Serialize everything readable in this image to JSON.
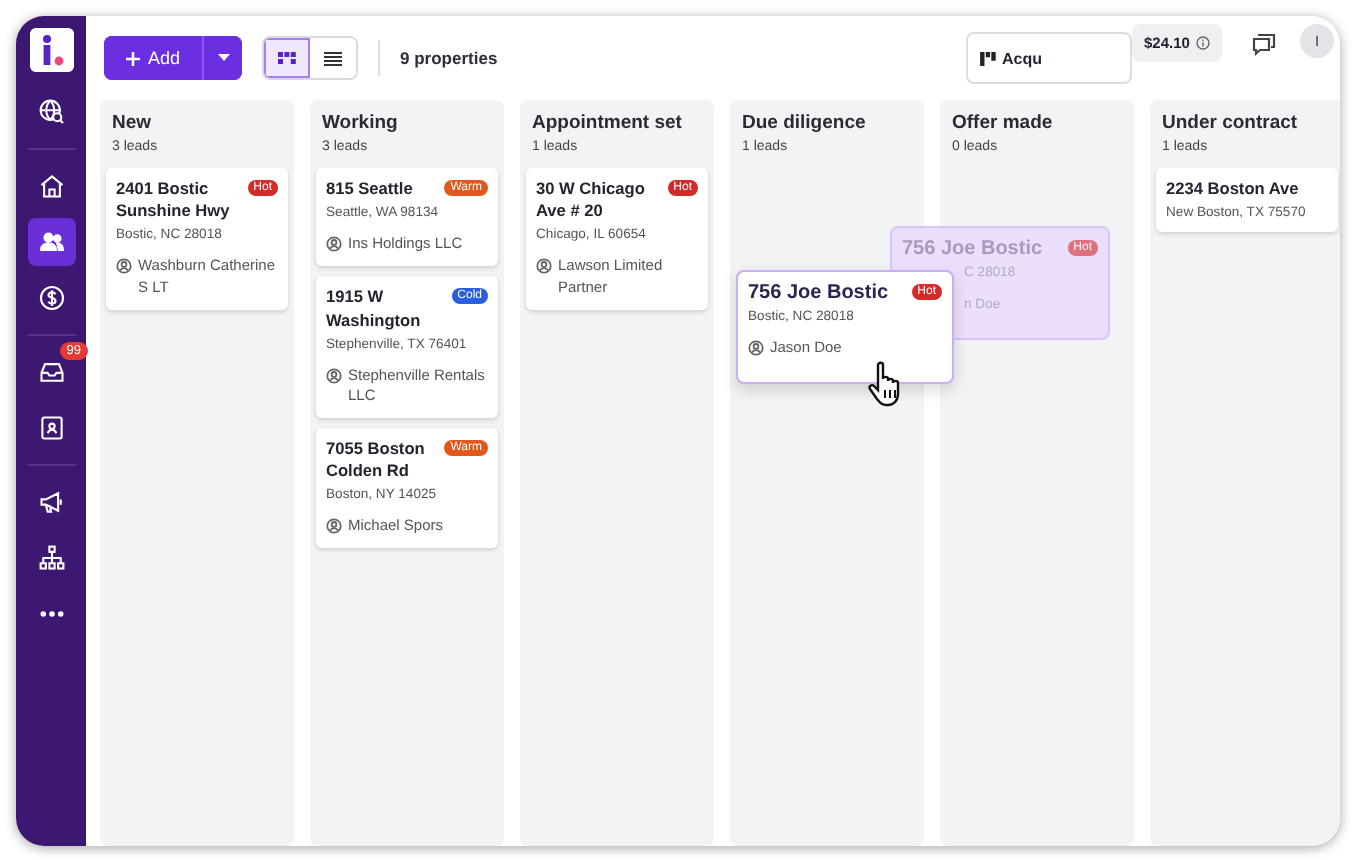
{
  "sidebar": {
    "items": [
      {
        "selected": false
      },
      {
        "selected": false
      },
      {
        "selected": true
      },
      {
        "selected": false
      },
      {
        "selected": false,
        "badge": "99"
      },
      {
        "selected": false
      },
      {
        "selected": false
      },
      {
        "selected": false
      },
      {
        "selected": false
      }
    ]
  },
  "toolbar": {
    "add_button": "Add",
    "views": [
      {
        "selected": true
      },
      {
        "selected": false
      }
    ],
    "count": "9 properties",
    "filter": "Acqu",
    "balance": "$24.10",
    "avatar": "I"
  },
  "columns": [
    {
      "title": "New",
      "count": "3 leads",
      "cards": [
        {
          "title": "2401 Bostic Sunshine Hwy",
          "tag": {
            "label": "Hot",
            "kind": "hot"
          },
          "address": "Bostic, NC 28018",
          "owner": "Washburn Catherine S LT"
        }
      ]
    },
    {
      "title": "Working",
      "count": "3 leads",
      "cards": [
        {
          "title": "815 Seattle",
          "tag": {
            "label": "Warm",
            "kind": "warm"
          },
          "address": "Seattle, WA 98134",
          "owner": "Ins Holdings LLC"
        },
        {
          "title": "1915 W Washington",
          "tag": {
            "label": "Cold",
            "kind": "cold"
          },
          "address": "Stephenville, TX 76401",
          "owner": "Stephenville Rentals LLC"
        },
        {
          "title": "7055 Boston Colden  Rd",
          "tag": {
            "label": "Warm",
            "kind": "warm"
          },
          "address": "Boston, NY 14025",
          "owner": "Michael Spors"
        }
      ]
    },
    {
      "title": "Appointment set",
      "count": "1 leads",
      "cards": [
        {
          "title": "30 W Chicago Ave # 20",
          "tag": {
            "label": "Hot",
            "kind": "hot"
          },
          "address": "Chicago, IL 60654",
          "owner": "Lawson Limited Partner"
        }
      ]
    },
    {
      "title": "Due diligence",
      "count": "1 leads"
    },
    {
      "title": "Offer made",
      "count": "0 leads"
    },
    {
      "title": "Under contract",
      "count": "1 leads",
      "cards": [
        {
          "title": "2234 Boston Ave",
          "address": "New Boston, TX 75570"
        }
      ]
    }
  ],
  "drag_ghost": {
    "title": "756 Joe Bostic",
    "tag": {
      "label": "Hot",
      "kind": "hot"
    },
    "address": "C 28018",
    "owner": "n Doe"
  },
  "drag_card": {
    "title": "756 Joe Bostic",
    "tag": {
      "label": "Hot",
      "kind": "hot"
    },
    "address": "Bostic, NC 28018",
    "owner": "Jason Doe"
  }
}
